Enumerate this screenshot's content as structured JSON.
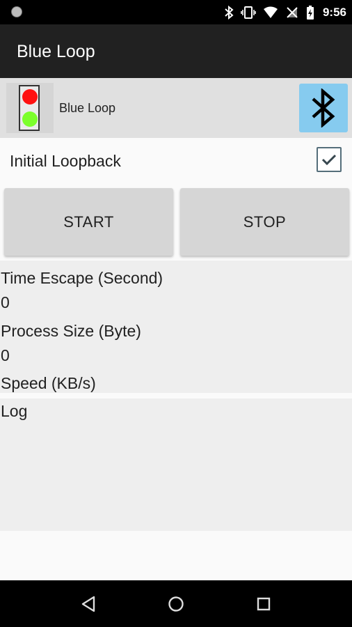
{
  "status_bar": {
    "time": "9:56",
    "icons": [
      "notification-dot-icon",
      "bluetooth-icon",
      "vibrate-icon",
      "wifi-icon",
      "no-sim-icon",
      "battery-charging-icon"
    ]
  },
  "toolbar": {
    "title": "Blue Loop"
  },
  "connection": {
    "device_name": "Blue Loop",
    "light_colors": {
      "red": "#ff1111",
      "green": "#7cff2b"
    },
    "bluetooth_button_color": "#86cbef"
  },
  "settings": {
    "initial_loopback_label": "Initial Loopback",
    "initial_loopback_checked": true
  },
  "buttons": {
    "start_label": "START",
    "stop_label": "STOP"
  },
  "stats": {
    "time_label": "Time Escape (Second)",
    "time_value": "0",
    "size_label": "Process Size (Byte)",
    "size_value": "0",
    "speed_label": "Speed (KB/s)"
  },
  "log": {
    "label": "Log"
  },
  "nav": {
    "icons": [
      "back-icon",
      "home-icon",
      "recents-icon"
    ]
  }
}
